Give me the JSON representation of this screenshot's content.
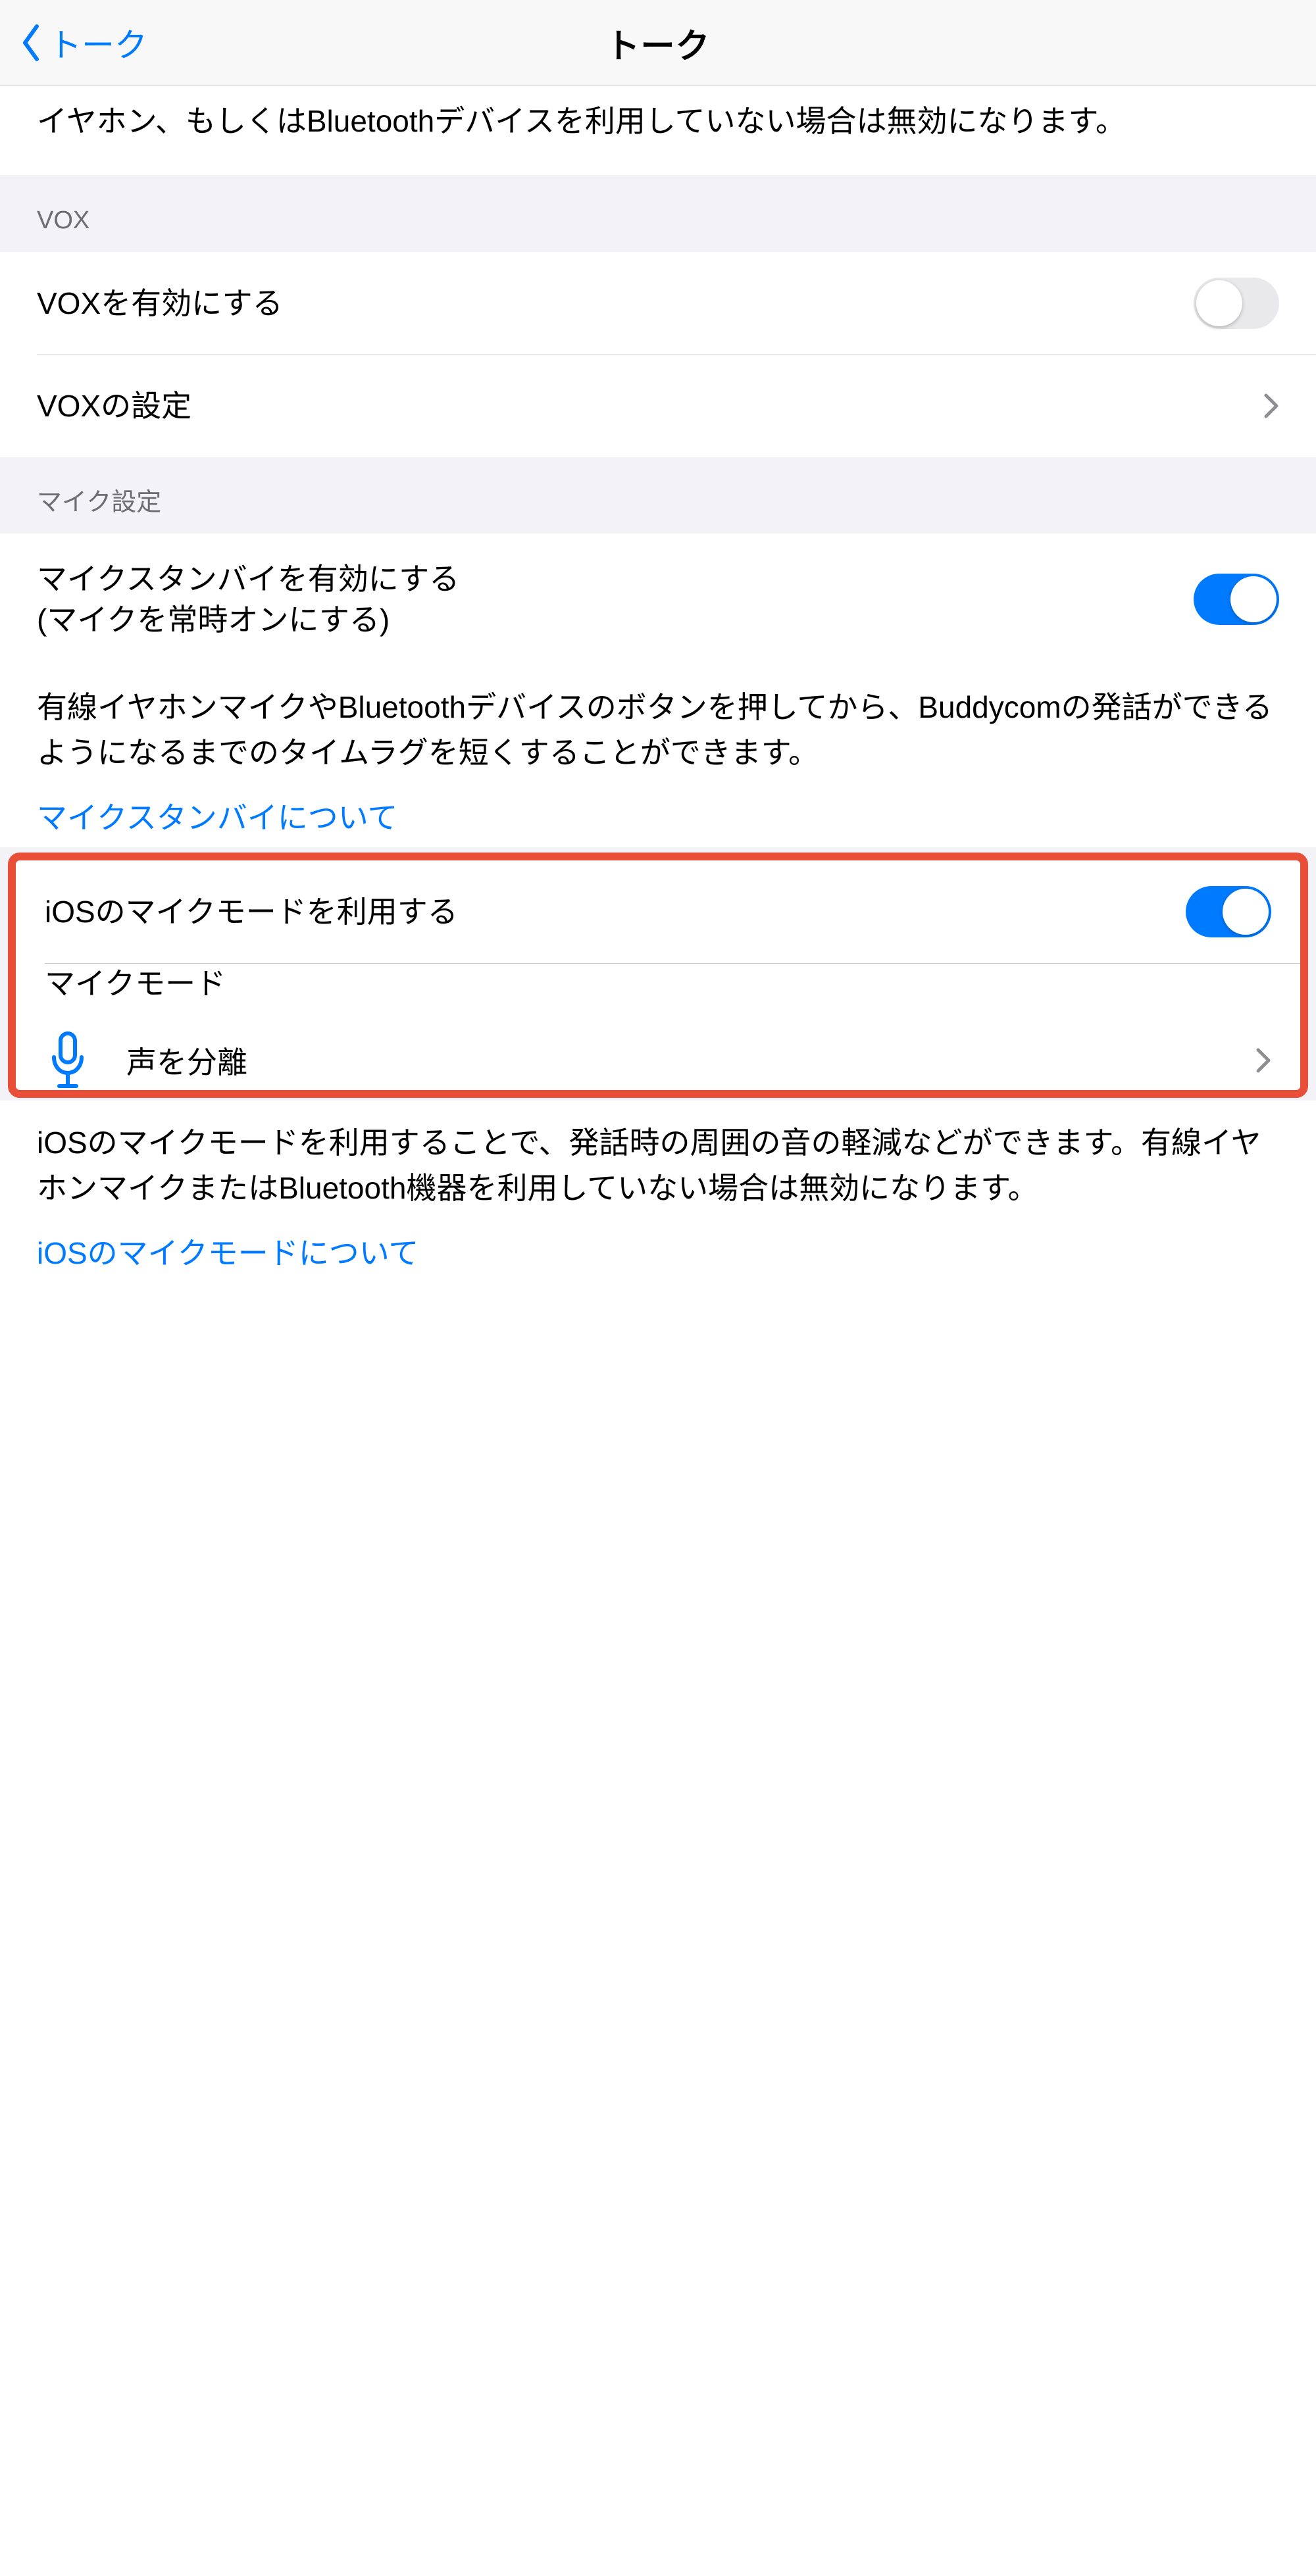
{
  "nav": {
    "back_label": "トーク",
    "title": "トーク"
  },
  "top_note": "イヤホン、もしくはBluetoothデバイスを利用していない場合は無効になります。",
  "vox": {
    "header": "VOX",
    "enable_label": "VOXを有効にする",
    "enable_state": "off",
    "settings_label": "VOXの設定"
  },
  "mic": {
    "header": "マイク設定",
    "standby_label_line1": "マイクスタンバイを有効にする",
    "standby_label_line2": "(マイクを常時オンにする)",
    "standby_state": "on",
    "standby_note": "有線イヤホンマイクやBluetoothデバイスのボタンを押してから、Buddycomの発話ができるようになるまでのタイムラグを短くすることができます。",
    "standby_link": "マイクスタンバイについて",
    "ios_mode_enable_label": "iOSのマイクモードを利用する",
    "ios_mode_enable_state": "on",
    "ios_mode_section_label": "マイクモード",
    "ios_mode_value": "声を分離",
    "ios_mode_note": "iOSのマイクモードを利用することで、発話時の周囲の音の軽減などができます。有線イヤホンマイクまたはBluetooth機器を利用していない場合は無効になります。",
    "ios_mode_link": "iOSのマイクモードについて"
  }
}
